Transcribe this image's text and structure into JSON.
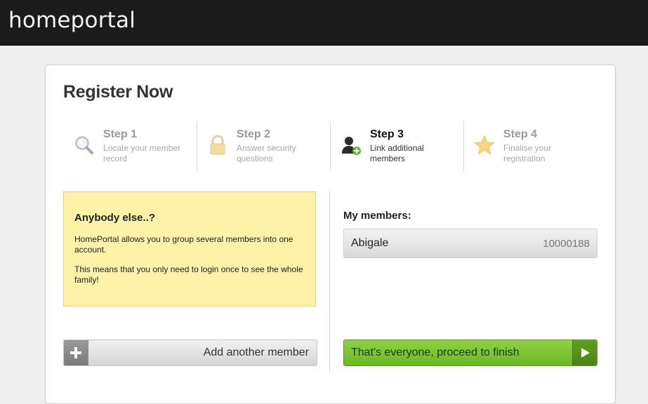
{
  "app": {
    "brand": "homeportal"
  },
  "page": {
    "title": "Register Now"
  },
  "steps": [
    {
      "title": "Step 1",
      "desc": "Locate your member record",
      "icon": "search-icon",
      "state": "inactive"
    },
    {
      "title": "Step 2",
      "desc": "Answer security questions",
      "icon": "lock-icon",
      "state": "inactive"
    },
    {
      "title": "Step 3",
      "desc": "Link additional members",
      "icon": "add-user-icon",
      "state": "active"
    },
    {
      "title": "Step 4",
      "desc": "Finalise your registration",
      "icon": "star-icon",
      "state": "inactive"
    }
  ],
  "info": {
    "heading": "Anybody else..?",
    "paragraph1": "HomePortal allows you to group several members into one account.",
    "paragraph2": "This means that you only need to login once to see the whole family!"
  },
  "members": {
    "heading": "My members:",
    "list": [
      {
        "name": "Abigale",
        "id": "10000188"
      }
    ]
  },
  "actions": {
    "add_label": "Add another member",
    "finish_label": "That's everyone, proceed to finish"
  },
  "colors": {
    "topbar": "#1b1b1b",
    "info_bg": "#fdf2a8",
    "finish_green": "#7cc435"
  }
}
